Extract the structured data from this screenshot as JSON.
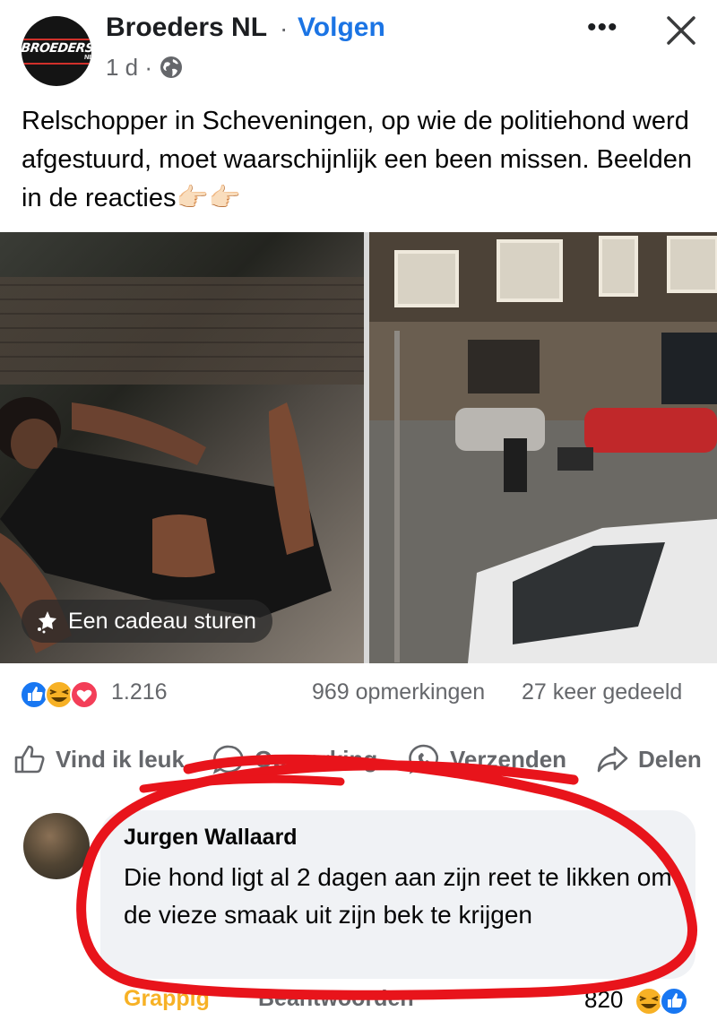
{
  "post": {
    "page_name": "Broeders NL",
    "separator": "·",
    "follow_label": "Volgen",
    "time": "1 d ·",
    "more_label": "•••",
    "avatar_logo": "BROEDERS",
    "avatar_logo_sub": "NL",
    "caption": "Relschopper in Scheveningen, op wie de politiehond werd afgestuurd, moet waarschijnlijk een been missen. Beelden in de reacties👉🏻👉🏻",
    "gift_label": "Een cadeau sturen",
    "reaction_count": "1.216",
    "comments_count": "969 opmerkingen",
    "shares_count": "27 keer gedeeld",
    "actions": {
      "like": "Vind ik leuk",
      "comment": "Opmerking",
      "send": "Verzenden",
      "share": "Delen"
    }
  },
  "comment": {
    "author": "Jurgen Wallaard",
    "text": "Die hond ligt al 2 dagen aan zijn reet te likken om de vieze smaak uit zijn bek te krijgen",
    "reaction_label": "Grappig",
    "reply_label": "Beantwoorden",
    "reaction_count": "820"
  },
  "colors": {
    "accent": "#1b74e4",
    "secondary_text": "#65676b",
    "haha": "#f7b125",
    "love": "#f33e58",
    "highlight_scribble": "#e8141b"
  },
  "icons": [
    "globe-icon",
    "close-icon",
    "gift-icon",
    "like-icon",
    "comment-icon",
    "messenger-icon",
    "share-icon"
  ]
}
